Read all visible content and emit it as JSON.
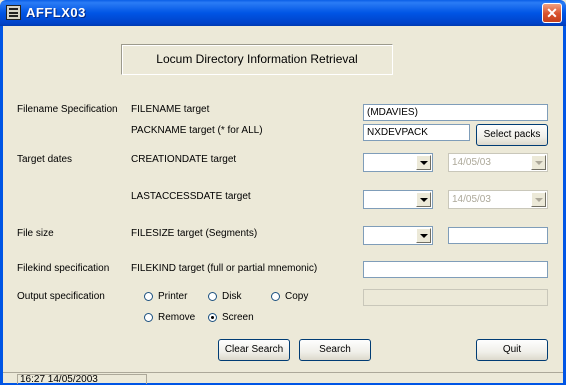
{
  "window": {
    "title": "AFFLX03",
    "close_label": "✕",
    "app_icon": "app-window-icon",
    "close_icon": "close-icon"
  },
  "header": "Locum Directory Information Retrieval",
  "sections": {
    "filename": "Filename Specification",
    "dates": "Target dates",
    "filesize": "File size",
    "filekind": "Filekind specification",
    "output": "Output specification"
  },
  "fields": {
    "filename": {
      "label": "FILENAME target",
      "value": "(MDAVIES)"
    },
    "packname": {
      "label": "PACKNAME target (* for ALL)",
      "value": "NXDEVPACK"
    },
    "creationdate": {
      "label": "CREATIONDATE target",
      "operator": "",
      "date": "14/05/03"
    },
    "lastaccessdate": {
      "label": "LASTACCESSDATE target",
      "operator": "",
      "date": "14/05/03"
    },
    "filesize": {
      "label": "FILESIZE target (Segments)",
      "operator": "",
      "value": ""
    },
    "filekind": {
      "label": "FILEKIND target (full or partial mnemonic)",
      "value": ""
    },
    "output_copy_target": ""
  },
  "output_options": {
    "printer": {
      "label": "Printer",
      "selected": false
    },
    "disk": {
      "label": "Disk",
      "selected": false
    },
    "copy": {
      "label": "Copy",
      "selected": false
    },
    "remove": {
      "label": "Remove",
      "selected": false
    },
    "screen": {
      "label": "Screen",
      "selected": true
    }
  },
  "buttons": {
    "select_packs": "Select packs",
    "clear_search": "Clear Search",
    "search": "Search",
    "quit": "Quit"
  },
  "status": "16:27 14/05/2003"
}
